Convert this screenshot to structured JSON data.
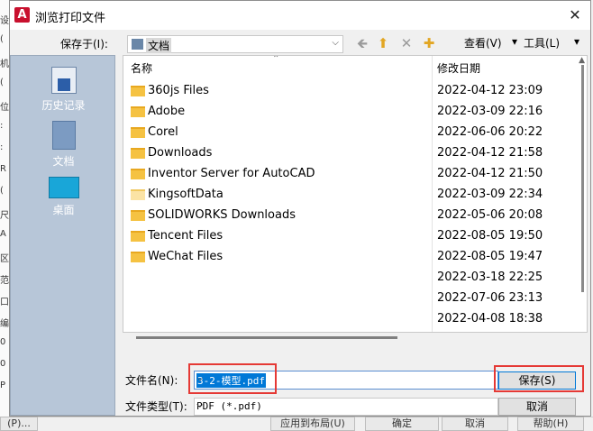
{
  "background": {
    "left_fragments": [
      "设",
      "(",
      "机",
      "(",
      "位",
      ":",
      ":",
      "R",
      "(",
      "尺",
      "A",
      "区",
      "范",
      "口",
      "编",
      "0",
      "0",
      "P"
    ],
    "bottom_buttons": [
      "(P)...",
      "应用到布局(U)",
      "确定",
      "取消",
      "帮助(H)"
    ]
  },
  "dialog": {
    "title": "浏览打印文件",
    "app_icon_letter": "A",
    "close_glyph": "✕",
    "save_in": {
      "label": "保存于(I):",
      "value": "文档"
    },
    "toolbar": {
      "view_label": "查看(V)",
      "tools_label": "工具(L)",
      "icons": [
        "back-arrow-icon",
        "up-folder-icon",
        "delete-icon",
        "new-folder-icon"
      ]
    },
    "places": [
      {
        "label": "历史记录",
        "icon": "history-icon"
      },
      {
        "label": "文档",
        "icon": "documents-icon"
      },
      {
        "label": "桌面",
        "icon": "desktop-icon"
      }
    ],
    "list": {
      "columns": [
        "名称",
        "修改日期"
      ],
      "rows": [
        {
          "name": "360js Files",
          "date": "2022-04-12 23:09"
        },
        {
          "name": "Adobe",
          "date": "2022-03-09 22:16"
        },
        {
          "name": "Corel",
          "date": "2022-06-06 20:22"
        },
        {
          "name": "Downloads",
          "date": "2022-04-12 21:58"
        },
        {
          "name": "Inventor Server for AutoCAD",
          "date": "2022-04-12 21:50"
        },
        {
          "name": "KingsoftData",
          "date": "2022-03-09 22:34"
        },
        {
          "name": "SOLIDWORKS Downloads",
          "date": "2022-05-06 20:08"
        },
        {
          "name": "Tencent Files",
          "date": "2022-08-05 19:50"
        },
        {
          "name": "WeChat Files",
          "date": "2022-08-05 19:47"
        },
        {
          "name": "",
          "date": "2022-03-18 22:25"
        },
        {
          "name": "",
          "date": "2022-07-06 23:13"
        },
        {
          "name": "",
          "date": "2022-04-08 18:38"
        }
      ]
    },
    "filename": {
      "label": "文件名(N):",
      "value": "3-2-模型.pdf"
    },
    "filetype": {
      "label": "文件类型(T):",
      "value": "PDF (*.pdf)"
    },
    "save_button": "保存(S)",
    "cancel_button": "取消",
    "accent": "#0078d7",
    "highlight": "#e53935"
  }
}
